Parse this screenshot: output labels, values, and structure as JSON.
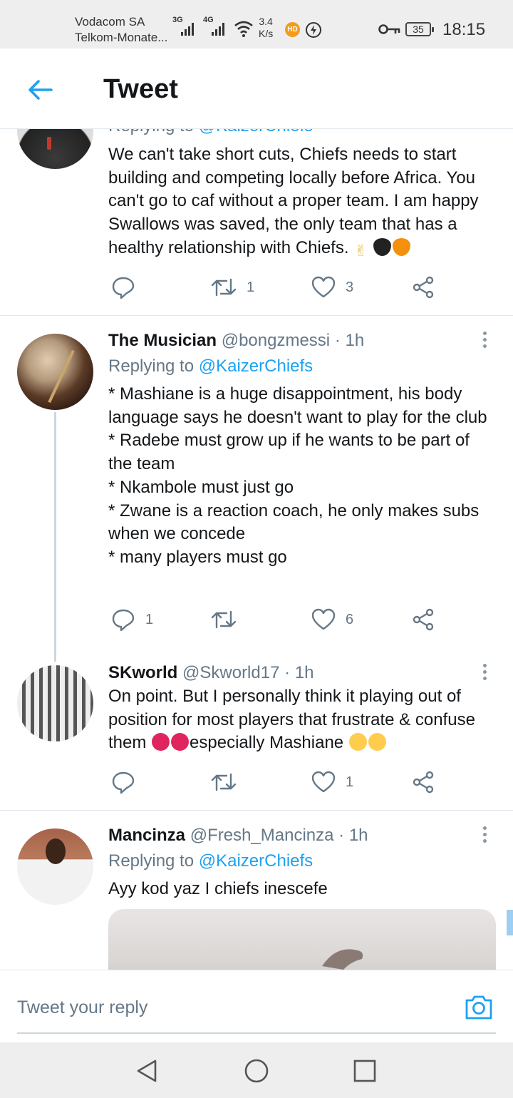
{
  "status_bar": {
    "carrier_1": "Vodacom SA",
    "carrier_2": "Telkom-Monate...",
    "network_1": "3G",
    "network_2": "4G",
    "speed_value": "3.4",
    "speed_unit": "K/s",
    "hd_badge": "HD",
    "battery": "35",
    "time": "18:15"
  },
  "header": {
    "title": "Tweet"
  },
  "tweets": [
    {
      "replying_prefix": "Replying to",
      "replying_to": "@KaizerChiefs",
      "text": "We can't take short cuts, Chiefs needs to start building and competing locally before Africa. You can't go to caf without a proper team. I am happy Swallows was saved, the only team that has a healthy relationship with Chiefs.",
      "emojis": [
        "victory-hand",
        "black-heart",
        "orange-heart"
      ],
      "replies": "",
      "retweets": "1",
      "likes": "3"
    },
    {
      "name": "The Musician",
      "handle": "@bongzmessi",
      "time": "· 1h",
      "replying_prefix": "Replying to",
      "replying_to": "@KaizerChiefs",
      "lines": [
        "* Mashiane is a huge disappointment, his body language says he doesn't want to play for the club",
        "* Radebe must grow up if he wants to be part of the team",
        "* Nkambole must just go",
        "* Zwane is a reaction coach, he only makes subs when we concede",
        "* many players must go"
      ],
      "replies": "1",
      "retweets": "",
      "likes": "6"
    },
    {
      "name": "SKworld",
      "handle": "@Skworld17",
      "time": "· 1h",
      "text_before": "On point. But I personally think it playing out of position for most players that frustrate & confuse them",
      "text_after": "especially Mashiane",
      "emojis": [
        "angry-face",
        "angry-face",
        "steam-face",
        "steam-face"
      ],
      "replies": "",
      "retweets": "",
      "likes": "1"
    },
    {
      "name": "Mancinza",
      "handle": "@Fresh_Mancinza",
      "time": "· 1h",
      "replying_prefix": "Replying to",
      "replying_to": "@KaizerChiefs",
      "text": "Ayy kod yaz I chiefs inescefe"
    }
  ],
  "reply_bar": {
    "placeholder": "Tweet your reply"
  },
  "colors": {
    "accent": "#1da1f2",
    "secondary_text": "#657786",
    "divider": "#e1e8ed"
  }
}
